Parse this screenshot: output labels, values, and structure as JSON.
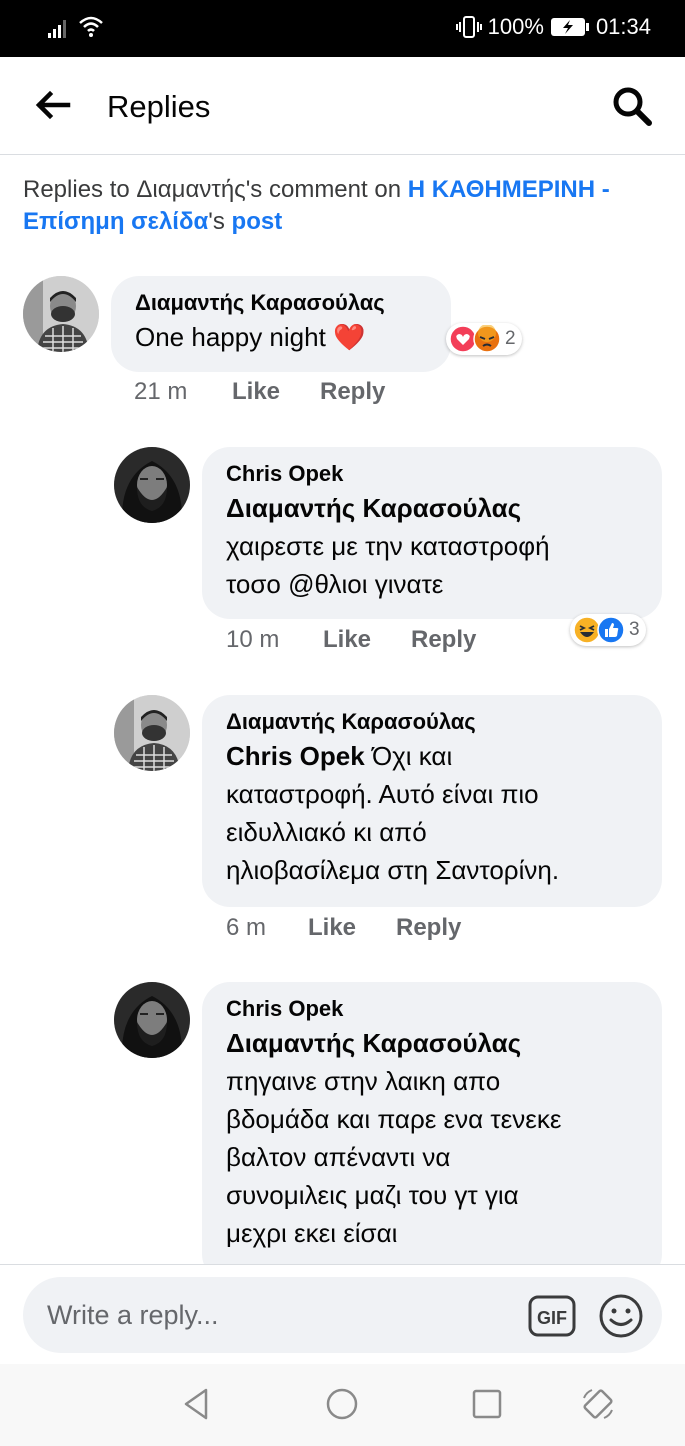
{
  "status_bar": {
    "battery": "100%",
    "time": "01:34",
    "icons": [
      "signal-icon",
      "wifi-icon",
      "vibrate-icon",
      "battery-charging-icon"
    ]
  },
  "header": {
    "title": "Replies",
    "back_icon": "back-arrow-icon",
    "search_icon": "search-icon"
  },
  "context": {
    "prefix": "Replies to Διαμαντής's comment on ",
    "page_name": "Η ΚΑΘΗΜΕΡΙΝΗ - Επίσημη σελίδα",
    "middle": "'s ",
    "post_label": "post"
  },
  "comments": [
    {
      "author": "Διαμαντής Καρασούλας",
      "mention": "",
      "text": "One happy night ❤️",
      "time": "21 m",
      "like": "Like",
      "reply": "Reply",
      "reaction_icons": [
        "love-reaction-icon",
        "angry-reaction-icon"
      ],
      "reaction_count": "2"
    },
    {
      "author": "Chris Opek",
      "mention": "Διαμαντής Καρασούλας",
      "text_lines": [
        "χαιρεστε με την καταστροφή",
        "τοσο @θλιοι γινατε"
      ],
      "time": "10 m",
      "like": "Like",
      "reply": "Reply",
      "reaction_icons": [
        "haha-reaction-icon",
        "like-reaction-icon"
      ],
      "reaction_count": "3"
    },
    {
      "author": "Διαμαντής Καρασούλας",
      "mention": "Chris Opek",
      "text_first": " Όχι και",
      "text_lines": [
        "καταστροφή. Αυτό είναι πιο",
        "ειδυλλιακό κι από",
        "ηλιοβασίλεμα στη Σαντορίνη."
      ],
      "time": "6 m",
      "like": "Like",
      "reply": "Reply"
    },
    {
      "author": "Chris Opek",
      "mention": "Διαμαντής Καρασούλας",
      "text_lines": [
        "πηγαινε στην λαικη απο",
        "βδομάδα και παρε ενα τενεκε",
        "βαλτον απέναντι να",
        "συνομιλεις μαζι του γτ για",
        "μεχρι εκει είσαι"
      ]
    }
  ],
  "composer": {
    "placeholder": "Write a reply...",
    "gif_label": "GIF",
    "emoji_icon": "smiley-icon"
  },
  "nav_bar": {
    "icons": [
      "back-triangle-icon",
      "home-circle-icon",
      "recents-square-icon",
      "rotate-icon"
    ]
  },
  "colors": {
    "link_blue": "#1877f2",
    "bubble_gray": "#f0f2f5",
    "meta_gray": "#65676b"
  }
}
